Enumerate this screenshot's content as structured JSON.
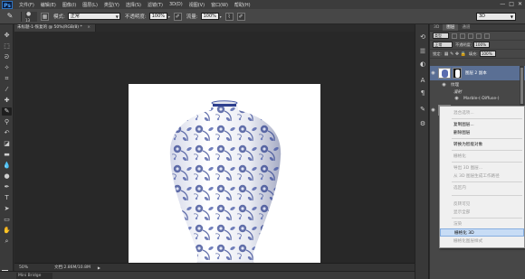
{
  "app": {
    "logo": "Ps",
    "menu": [
      "文件(F)",
      "编辑(E)",
      "图像(I)",
      "图层(L)",
      "类型(Y)",
      "选择(S)",
      "滤镜(T)",
      "3D(D)",
      "视图(V)",
      "窗口(W)",
      "帮助(H)"
    ],
    "window_controls": [
      "—",
      "□",
      "✕"
    ]
  },
  "options": {
    "brush_size": "13",
    "mode_label": "模式:",
    "mode_value": "正常",
    "opacity_label": "不透明度:",
    "opacity_value": "100%",
    "flow_label": "流量:",
    "flow_value": "100%",
    "workspace": "3D"
  },
  "document": {
    "tab_title": "未标题-1-恢复的 @ 50%(RGB/8) *",
    "tab_close": "×",
    "zoom": "50%",
    "doc_info": "文档:2.86M/10.8M",
    "bottom_tab": "Mini Bridge"
  },
  "layers_panel": {
    "tabs": [
      "3D",
      "图层",
      "通道"
    ],
    "kind": "类型",
    "blend_mode": "正常",
    "opacity_label": "不透明度:",
    "opacity_value": "100%",
    "lock_label": "锁定:",
    "fill_label": "填充:",
    "fill_value": "100%",
    "layers": [
      {
        "name": "图层 2 副本"
      },
      {
        "name": "纹理"
      },
      {
        "name": "漫射"
      },
      {
        "name": "Marble-(-Diffuse-)"
      }
    ]
  },
  "context_menu": {
    "items": [
      {
        "label": "混合选项...",
        "enabled": false
      },
      {
        "label": "复制图层...",
        "enabled": true
      },
      {
        "label": "删除图层",
        "enabled": true
      },
      {
        "label": "转换为智能对象",
        "enabled": true
      },
      {
        "label": "栅格化",
        "enabled": false
      },
      {
        "label": "导出 3D 图层...",
        "enabled": false
      },
      {
        "label": "从 3D 图层生成工作路径",
        "enabled": false
      },
      {
        "label": "选区内",
        "enabled": false
      },
      {
        "label": "反转可见",
        "enabled": false
      },
      {
        "label": "显示全部",
        "enabled": false
      },
      {
        "label": "渲染",
        "enabled": false
      },
      {
        "label": "栅格化 3D",
        "enabled": true,
        "highlighted": true
      },
      {
        "label": "栅格化图层样式",
        "enabled": false
      }
    ]
  },
  "colors": {
    "background": "#2b2b2b",
    "canvas": "#ffffff",
    "vase_blue": "#2d3f8e",
    "highlight": "#c7dcf5"
  }
}
